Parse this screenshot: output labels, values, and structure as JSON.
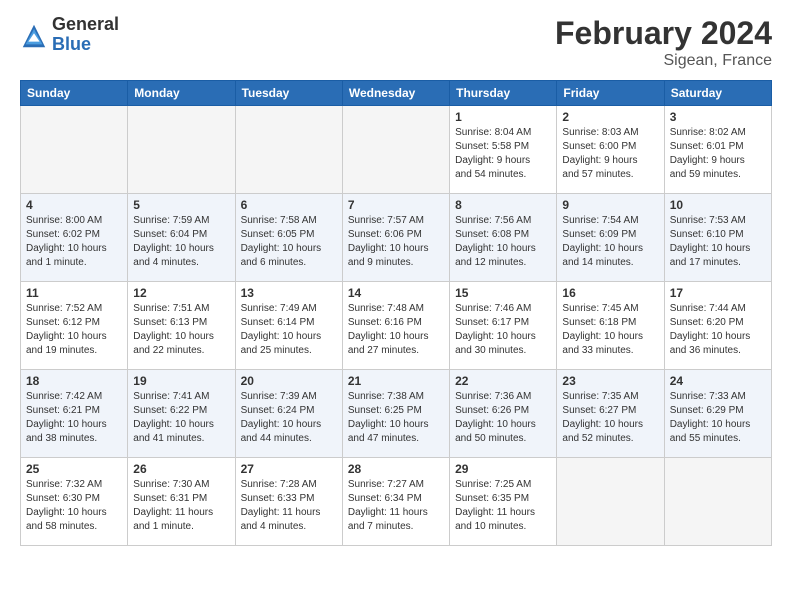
{
  "header": {
    "logo": {
      "general": "General",
      "blue": "Blue"
    },
    "title": "February 2024",
    "location": "Sigean, France"
  },
  "weekdays": [
    "Sunday",
    "Monday",
    "Tuesday",
    "Wednesday",
    "Thursday",
    "Friday",
    "Saturday"
  ],
  "weeks": [
    {
      "shade": false,
      "days": [
        {
          "num": "",
          "info": ""
        },
        {
          "num": "",
          "info": ""
        },
        {
          "num": "",
          "info": ""
        },
        {
          "num": "",
          "info": ""
        },
        {
          "num": "1",
          "info": "Sunrise: 8:04 AM\nSunset: 5:58 PM\nDaylight: 9 hours\nand 54 minutes."
        },
        {
          "num": "2",
          "info": "Sunrise: 8:03 AM\nSunset: 6:00 PM\nDaylight: 9 hours\nand 57 minutes."
        },
        {
          "num": "3",
          "info": "Sunrise: 8:02 AM\nSunset: 6:01 PM\nDaylight: 9 hours\nand 59 minutes."
        }
      ]
    },
    {
      "shade": true,
      "days": [
        {
          "num": "4",
          "info": "Sunrise: 8:00 AM\nSunset: 6:02 PM\nDaylight: 10 hours\nand 1 minute."
        },
        {
          "num": "5",
          "info": "Sunrise: 7:59 AM\nSunset: 6:04 PM\nDaylight: 10 hours\nand 4 minutes."
        },
        {
          "num": "6",
          "info": "Sunrise: 7:58 AM\nSunset: 6:05 PM\nDaylight: 10 hours\nand 6 minutes."
        },
        {
          "num": "7",
          "info": "Sunrise: 7:57 AM\nSunset: 6:06 PM\nDaylight: 10 hours\nand 9 minutes."
        },
        {
          "num": "8",
          "info": "Sunrise: 7:56 AM\nSunset: 6:08 PM\nDaylight: 10 hours\nand 12 minutes."
        },
        {
          "num": "9",
          "info": "Sunrise: 7:54 AM\nSunset: 6:09 PM\nDaylight: 10 hours\nand 14 minutes."
        },
        {
          "num": "10",
          "info": "Sunrise: 7:53 AM\nSunset: 6:10 PM\nDaylight: 10 hours\nand 17 minutes."
        }
      ]
    },
    {
      "shade": false,
      "days": [
        {
          "num": "11",
          "info": "Sunrise: 7:52 AM\nSunset: 6:12 PM\nDaylight: 10 hours\nand 19 minutes."
        },
        {
          "num": "12",
          "info": "Sunrise: 7:51 AM\nSunset: 6:13 PM\nDaylight: 10 hours\nand 22 minutes."
        },
        {
          "num": "13",
          "info": "Sunrise: 7:49 AM\nSunset: 6:14 PM\nDaylight: 10 hours\nand 25 minutes."
        },
        {
          "num": "14",
          "info": "Sunrise: 7:48 AM\nSunset: 6:16 PM\nDaylight: 10 hours\nand 27 minutes."
        },
        {
          "num": "15",
          "info": "Sunrise: 7:46 AM\nSunset: 6:17 PM\nDaylight: 10 hours\nand 30 minutes."
        },
        {
          "num": "16",
          "info": "Sunrise: 7:45 AM\nSunset: 6:18 PM\nDaylight: 10 hours\nand 33 minutes."
        },
        {
          "num": "17",
          "info": "Sunrise: 7:44 AM\nSunset: 6:20 PM\nDaylight: 10 hours\nand 36 minutes."
        }
      ]
    },
    {
      "shade": true,
      "days": [
        {
          "num": "18",
          "info": "Sunrise: 7:42 AM\nSunset: 6:21 PM\nDaylight: 10 hours\nand 38 minutes."
        },
        {
          "num": "19",
          "info": "Sunrise: 7:41 AM\nSunset: 6:22 PM\nDaylight: 10 hours\nand 41 minutes."
        },
        {
          "num": "20",
          "info": "Sunrise: 7:39 AM\nSunset: 6:24 PM\nDaylight: 10 hours\nand 44 minutes."
        },
        {
          "num": "21",
          "info": "Sunrise: 7:38 AM\nSunset: 6:25 PM\nDaylight: 10 hours\nand 47 minutes."
        },
        {
          "num": "22",
          "info": "Sunrise: 7:36 AM\nSunset: 6:26 PM\nDaylight: 10 hours\nand 50 minutes."
        },
        {
          "num": "23",
          "info": "Sunrise: 7:35 AM\nSunset: 6:27 PM\nDaylight: 10 hours\nand 52 minutes."
        },
        {
          "num": "24",
          "info": "Sunrise: 7:33 AM\nSunset: 6:29 PM\nDaylight: 10 hours\nand 55 minutes."
        }
      ]
    },
    {
      "shade": false,
      "days": [
        {
          "num": "25",
          "info": "Sunrise: 7:32 AM\nSunset: 6:30 PM\nDaylight: 10 hours\nand 58 minutes."
        },
        {
          "num": "26",
          "info": "Sunrise: 7:30 AM\nSunset: 6:31 PM\nDaylight: 11 hours\nand 1 minute."
        },
        {
          "num": "27",
          "info": "Sunrise: 7:28 AM\nSunset: 6:33 PM\nDaylight: 11 hours\nand 4 minutes."
        },
        {
          "num": "28",
          "info": "Sunrise: 7:27 AM\nSunset: 6:34 PM\nDaylight: 11 hours\nand 7 minutes."
        },
        {
          "num": "29",
          "info": "Sunrise: 7:25 AM\nSunset: 6:35 PM\nDaylight: 11 hours\nand 10 minutes."
        },
        {
          "num": "",
          "info": ""
        },
        {
          "num": "",
          "info": ""
        }
      ]
    }
  ]
}
